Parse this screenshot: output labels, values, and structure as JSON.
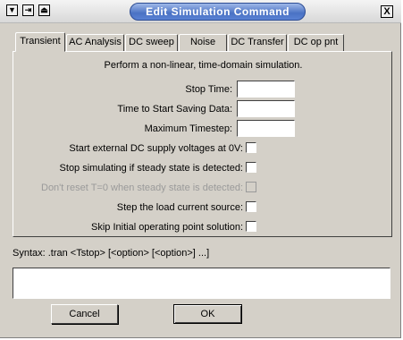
{
  "window": {
    "title": "Edit Simulation Command",
    "close_glyph": "X"
  },
  "title_buttons": [
    "menu-down-icon",
    "pin-icon",
    "eject-icon"
  ],
  "tabs": [
    {
      "label": "Transient",
      "active": true
    },
    {
      "label": "AC Analysis",
      "active": false
    },
    {
      "label": "DC sweep",
      "active": false
    },
    {
      "label": "Noise",
      "active": false
    },
    {
      "label": "DC Transfer",
      "active": false
    },
    {
      "label": "DC op pnt",
      "active": false
    }
  ],
  "transient": {
    "description": "Perform a non-linear, time-domain simulation.",
    "stop_time": {
      "label": "Stop Time:",
      "value": ""
    },
    "start_saving": {
      "label": "Time to Start Saving Data:",
      "value": ""
    },
    "max_timestep": {
      "label": "Maximum Timestep:",
      "value": ""
    },
    "start_dc_zero": {
      "label": "Start external DC supply voltages at 0V:",
      "checked": false
    },
    "stop_steady": {
      "label": "Stop simulating if steady state is detected:",
      "checked": false
    },
    "dont_reset": {
      "label": "Don't reset T=0 when steady state is detected:",
      "checked": false,
      "disabled": true
    },
    "step_load": {
      "label": "Step the load current source:",
      "checked": false
    },
    "skip_initial": {
      "label": "Skip Initial operating point solution:",
      "checked": false
    }
  },
  "syntax": {
    "text": "Syntax:  .tran <Tstop> [<option> [<option>] ...]",
    "value": ""
  },
  "buttons": {
    "cancel": "Cancel",
    "ok": "OK"
  },
  "colors": {
    "dialog_bg": "#d4d0c8",
    "title_pill": "#4a72c4",
    "disabled_text": "#9a9a9a"
  }
}
